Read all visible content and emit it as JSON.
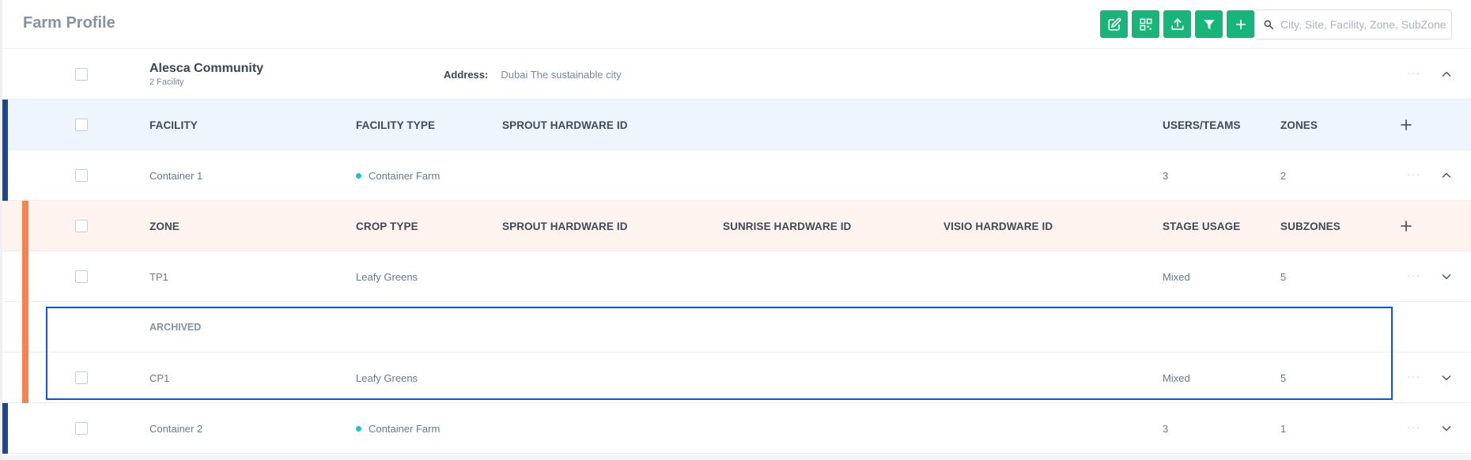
{
  "page": {
    "title": "Farm Profile"
  },
  "toolbar": {
    "buttons": [
      {
        "icon": "edit-icon"
      },
      {
        "icon": "qr-code-icon"
      },
      {
        "icon": "upload-icon"
      },
      {
        "icon": "filter-icon"
      },
      {
        "icon": "plus-icon"
      }
    ],
    "search_placeholder": "City, Site, Facility, Zone, SubZone",
    "accent": "#18b57a"
  },
  "community": {
    "name": "Alesca Community",
    "facility_count": "2 Facility",
    "address_label": "Address:",
    "address": "Dubai The sustainable city"
  },
  "facility_table": {
    "headers": {
      "facility": "FACILITY",
      "facility_type": "FACILITY TYPE",
      "sprout_hw": "SPROUT HARDWARE ID",
      "users_teams": "USERS/TEAMS",
      "zones": "ZONES"
    },
    "rows": [
      {
        "name": "Container 1",
        "type": "Container Farm",
        "sprout_hw": "",
        "users_teams": "3",
        "zones": "2",
        "expanded": true
      },
      {
        "name": "Container 2",
        "type": "Container Farm",
        "sprout_hw": "",
        "users_teams": "3",
        "zones": "1",
        "expanded": false
      }
    ]
  },
  "zone_table": {
    "headers": {
      "zone": "ZONE",
      "crop_type": "CROP TYPE",
      "sprout_hw": "SPROUT HARDWARE ID",
      "sunrise_hw": "SUNRISE HARDWARE ID",
      "visio_hw": "VISIO HARDWARE ID",
      "stage_usage": "STAGE USAGE",
      "subzones": "SUBZONES"
    },
    "rows": [
      {
        "zone": "TP1",
        "crop_type": "Leafy Greens",
        "stage_usage": "Mixed",
        "subzones": "5"
      }
    ],
    "archived_label": "ARCHIVED",
    "archived_rows": [
      {
        "zone": "CP1",
        "crop_type": "Leafy Greens",
        "stage_usage": "Mixed",
        "subzones": "5"
      }
    ]
  },
  "colors": {
    "facility_bar": "#1c4596",
    "zone_bar": "#f5824f",
    "facility_header_bg": "#eef5fd",
    "zone_header_bg": "#fff3f0",
    "archived_highlight": "#1454c9",
    "facility_type_dot": "#19c4d8"
  },
  "more_symbol": "···"
}
